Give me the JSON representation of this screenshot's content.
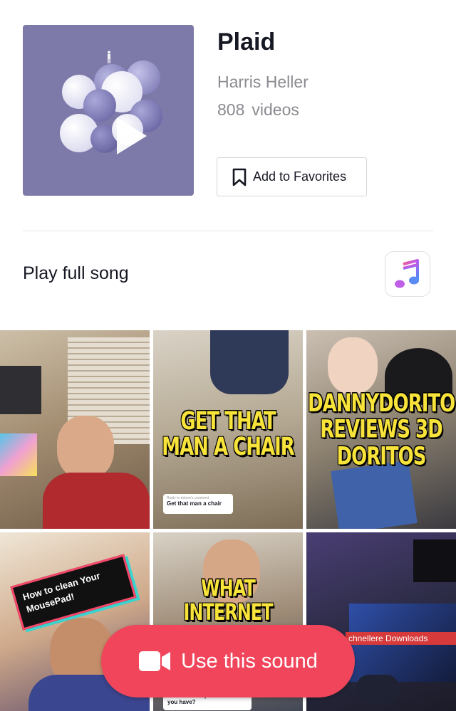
{
  "song": {
    "title": "Plaid",
    "artist": "Harris Heller",
    "video_count": "808",
    "video_unit": "videos"
  },
  "actions": {
    "favorites_label": "Add to Favorites",
    "play_full_label": "Play full song",
    "use_sound_label": "Use this sound"
  },
  "icons": {
    "play": "play-icon",
    "bookmark": "bookmark-icon",
    "music_app": "music-note-icon",
    "camera": "video-camera-icon"
  },
  "colors": {
    "accent": "#f0455b",
    "secondary_text": "#8a8b91",
    "caption_yellow": "#f7e33a"
  },
  "videos": [
    {
      "caption": ""
    },
    {
      "caption": "GET THAT MAN A CHAIR",
      "reply_meta": "Reply to tmtorn's comment",
      "reply_text": "Get that man a chair"
    },
    {
      "caption": "DANNYDORITO REVIEWS 3D DORITOS"
    },
    {
      "caption": "How to clean Your MousePad!"
    },
    {
      "caption": "WHAT INTERNET PROVIDER DO WE",
      "comment": "what internet provider do you have?"
    },
    {
      "banner": "chnellere Downloads"
    }
  ]
}
